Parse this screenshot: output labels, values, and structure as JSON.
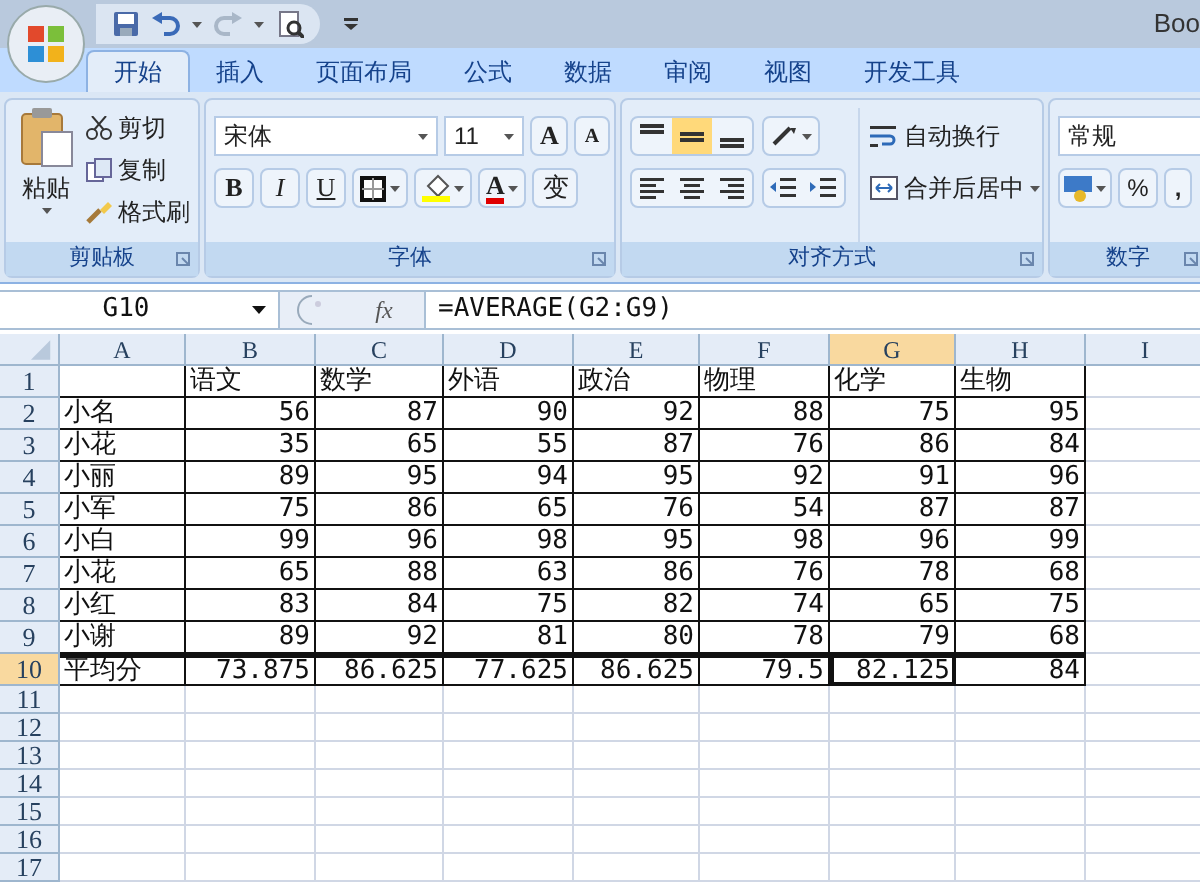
{
  "window": {
    "title": "Boo"
  },
  "tabs": [
    {
      "label": "开始",
      "selected": true
    },
    {
      "label": "插入",
      "selected": false
    },
    {
      "label": "页面布局",
      "selected": false
    },
    {
      "label": "公式",
      "selected": false
    },
    {
      "label": "数据",
      "selected": false
    },
    {
      "label": "审阅",
      "selected": false
    },
    {
      "label": "视图",
      "selected": false
    },
    {
      "label": "开发工具",
      "selected": false
    }
  ],
  "clipboard": {
    "label": "剪贴板",
    "paste": "粘贴",
    "items": [
      "剪切",
      "复制",
      "格式刷"
    ]
  },
  "font": {
    "label": "字体",
    "font_name": "宋体",
    "font_size": "11",
    "grow": "A",
    "shrink": "A",
    "styles": [
      "B",
      "I",
      "U"
    ],
    "font_color": "A",
    "phonetic": "变"
  },
  "alignment": {
    "label": "对齐方式",
    "vertical": [
      {
        "selected": false
      },
      {
        "selected": true
      },
      {
        "selected": false
      }
    ],
    "horizontal": [
      {
        "selected": false
      },
      {
        "selected": false
      },
      {
        "selected": false
      }
    ],
    "wrap": "自动换行",
    "merge": "合并后居中"
  },
  "number": {
    "label": "数字",
    "format": "常规",
    "percent": "%",
    "comma": ","
  },
  "formula_bar": {
    "name_box": "G10",
    "fx": "fx",
    "formula": "=AVERAGE(G2:G9)"
  },
  "sheet": {
    "columns": [
      {
        "label": "A",
        "selected": false
      },
      {
        "label": "B",
        "selected": false
      },
      {
        "label": "C",
        "selected": false
      },
      {
        "label": "D",
        "selected": false
      },
      {
        "label": "E",
        "selected": false
      },
      {
        "label": "F",
        "selected": false
      },
      {
        "label": "G",
        "selected": true
      },
      {
        "label": "H",
        "selected": false
      },
      {
        "label": "I",
        "selected": false
      }
    ],
    "rows": [
      {
        "number": "1",
        "kind": "header",
        "selected": false,
        "cells": [
          "",
          "语文",
          "数学",
          "外语",
          "政治",
          "物理",
          "化学",
          "生物"
        ]
      },
      {
        "number": "2",
        "kind": "data",
        "selected": false,
        "cells": [
          "小名",
          "56",
          "87",
          "90",
          "92",
          "88",
          "75",
          "95"
        ]
      },
      {
        "number": "3",
        "kind": "data",
        "selected": false,
        "cells": [
          "小花",
          "35",
          "65",
          "55",
          "87",
          "76",
          "86",
          "84"
        ]
      },
      {
        "number": "4",
        "kind": "data",
        "selected": false,
        "cells": [
          "小丽",
          "89",
          "95",
          "94",
          "95",
          "92",
          "91",
          "96"
        ]
      },
      {
        "number": "5",
        "kind": "data",
        "selected": false,
        "cells": [
          "小军",
          "75",
          "86",
          "65",
          "76",
          "54",
          "87",
          "87"
        ]
      },
      {
        "number": "6",
        "kind": "data",
        "selected": false,
        "cells": [
          "小白",
          "99",
          "96",
          "98",
          "95",
          "98",
          "96",
          "99"
        ]
      },
      {
        "number": "7",
        "kind": "data",
        "selected": false,
        "cells": [
          "小花",
          "65",
          "88",
          "63",
          "86",
          "76",
          "78",
          "68"
        ]
      },
      {
        "number": "8",
        "kind": "data",
        "selected": false,
        "cells": [
          "小红",
          "83",
          "84",
          "75",
          "82",
          "74",
          "65",
          "75"
        ]
      },
      {
        "number": "9",
        "kind": "data",
        "selected": false,
        "cells": [
          "小谢",
          "89",
          "92",
          "81",
          "80",
          "78",
          "79",
          "68"
        ]
      },
      {
        "number": "10",
        "kind": "data",
        "selected": true,
        "active_cells": [
          false,
          false,
          false,
          false,
          false,
          false,
          true,
          false
        ],
        "cells": [
          "平均分",
          "73.875",
          "86.625",
          "77.625",
          "86.625",
          "79.5",
          "82.125",
          "84"
        ]
      },
      {
        "number": "11",
        "kind": "empty",
        "selected": false
      },
      {
        "number": "12",
        "kind": "empty",
        "selected": false
      },
      {
        "number": "13",
        "kind": "empty",
        "selected": false
      },
      {
        "number": "14",
        "kind": "empty",
        "selected": false
      },
      {
        "number": "15",
        "kind": "empty",
        "selected": false
      },
      {
        "number": "16",
        "kind": "empty",
        "selected": false
      },
      {
        "number": "17",
        "kind": "empty",
        "selected": false
      }
    ]
  }
}
